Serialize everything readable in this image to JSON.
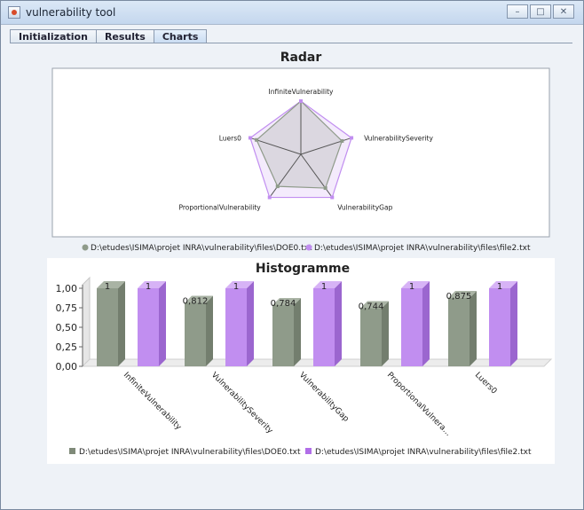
{
  "window": {
    "title": "vulnerability tool",
    "buttons": {
      "minimize": "–",
      "maximize": "□",
      "close": "✕"
    }
  },
  "tabs": [
    {
      "label": "Initialization",
      "active": false
    },
    {
      "label": "Results",
      "active": false
    },
    {
      "label": "Charts",
      "active": true
    }
  ],
  "legend": {
    "series1": "D:\\etudes\\ISIMA\\projet INRA\\vulnerability\\files\\DOE0.txt",
    "series2": "D:\\etudes\\ISIMA\\projet INRA\\vulnerability\\files\\file2.txt"
  },
  "colors": {
    "series1": "#8f9b8a",
    "series2": "#c18ef0"
  },
  "chart_data": [
    {
      "type": "radar",
      "title": "Radar",
      "axes": [
        "InfiniteVulnerability",
        "VulnerabilitySeverity",
        "VulnerabilityGap",
        "ProportionalVulnerability",
        "Luers0"
      ],
      "series": [
        {
          "name": "D:\\etudes\\ISIMA\\projet INRA\\vulnerability\\files\\DOE0.txt",
          "values": [
            1,
            0.812,
            0.784,
            0.744,
            0.875
          ]
        },
        {
          "name": "D:\\etudes\\ISIMA\\projet INRA\\vulnerability\\files\\file2.txt",
          "values": [
            1,
            1,
            1,
            1,
            1
          ]
        }
      ]
    },
    {
      "type": "bar",
      "title": "Histogramme",
      "categories": [
        "InfiniteVulnerability",
        "VulnerabilitySeverity",
        "VulnerabilityGap",
        "ProportionalVulnera...",
        "Luers0"
      ],
      "ylim": [
        0,
        1
      ],
      "yticks": [
        "0,00",
        "0,25",
        "0,50",
        "0,75",
        "1,00"
      ],
      "series": [
        {
          "name": "D:\\etudes\\ISIMA\\projet INRA\\vulnerability\\files\\DOE0.txt",
          "values": [
            1,
            0.812,
            0.784,
            0.744,
            0.875
          ],
          "labels": [
            "1",
            "0,812",
            "0,784",
            "0,744",
            "0,875"
          ]
        },
        {
          "name": "D:\\etudes\\ISIMA\\projet INRA\\vulnerability\\files\\file2.txt",
          "values": [
            1,
            1,
            1,
            1,
            1
          ],
          "labels": [
            "1",
            "1",
            "1",
            "1",
            "1"
          ]
        }
      ]
    }
  ]
}
